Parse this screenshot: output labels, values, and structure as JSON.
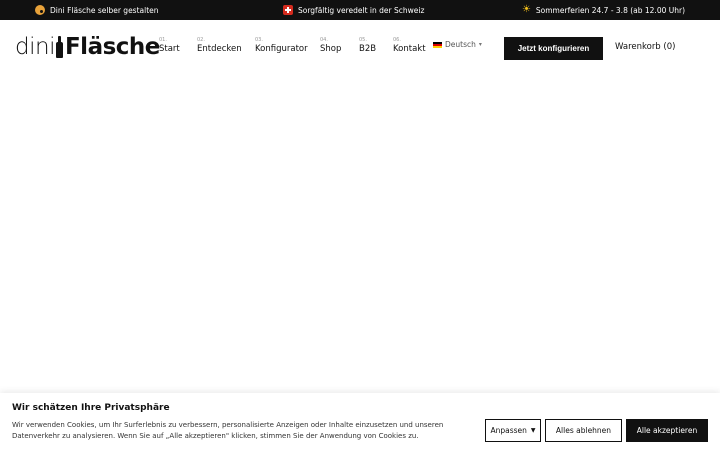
{
  "topbar": {
    "left_text": "Dini Fläsche selber gestalten",
    "left_icon": "palette-icon",
    "center_text": "Sorgfältig veredelt in der Schweiz",
    "center_icon": "swiss-flag-icon",
    "right_text": "Sommerferien 24.7 - 3.8 (ab 12.00 Uhr)",
    "right_icon": "sun-icon",
    "background": "#111111"
  },
  "logo": {
    "light": "dini",
    "bold": "Fläsche"
  },
  "nav": {
    "items": [
      {
        "num": "01.",
        "label": "Start"
      },
      {
        "num": "02.",
        "label": "Entdecken"
      },
      {
        "num": "03.",
        "label": "Konfigurator"
      },
      {
        "num": "04.",
        "label": "Shop"
      },
      {
        "num": "05.",
        "label": "B2B"
      },
      {
        "num": "06.",
        "label": "Kontakt"
      }
    ],
    "language": "Deutsch"
  },
  "header": {
    "cta_label": "Jetzt konfigurieren",
    "cart_label": "Warenkorb (0)"
  },
  "cookie": {
    "title": "Wir schätzen Ihre Privatsphäre",
    "text": "Wir verwenden Cookies, um Ihr Surferlebnis zu verbessern, personalisierte Anzeigen oder Inhalte einzusetzen und unseren Datenverkehr zu analysieren. Wenn Sie auf „Alle akzeptieren\" klicken, stimmen Sie der Anwendung von Cookies zu.",
    "customize_label": "Anpassen",
    "reject_label": "Alles ablehnen",
    "accept_label": "Alle akzeptieren"
  }
}
